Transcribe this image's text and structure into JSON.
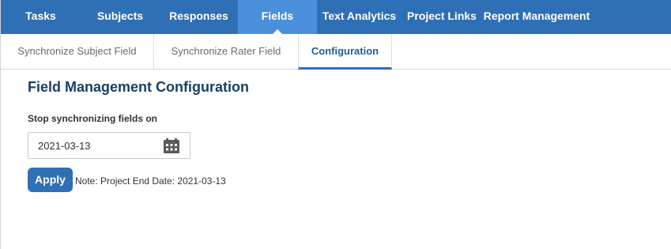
{
  "topnav": {
    "items": [
      {
        "label": "Tasks"
      },
      {
        "label": "Subjects"
      },
      {
        "label": "Responses"
      },
      {
        "label": "Fields"
      },
      {
        "label": "Text Analytics"
      },
      {
        "label": "Project Links"
      },
      {
        "label": "Report Management"
      }
    ],
    "active": "Fields"
  },
  "subtabs": {
    "items": [
      {
        "label": "Synchronize Subject Field"
      },
      {
        "label": "Synchronize Rater Field"
      },
      {
        "label": "Configuration"
      }
    ],
    "active": "Configuration"
  },
  "main": {
    "title": "Field Management Configuration",
    "field_label": "Stop synchronizing fields on",
    "date_value": "2021-03-13",
    "apply_label": "Apply",
    "note": "Note: Project End Date: 2021-03-13"
  },
  "colors": {
    "nav_background": "#2f6fb5",
    "nav_active": "#4a90db",
    "title": "#1a3f66",
    "button": "#2f6fb5"
  },
  "icons": {
    "date_picker": "calendar-icon"
  }
}
